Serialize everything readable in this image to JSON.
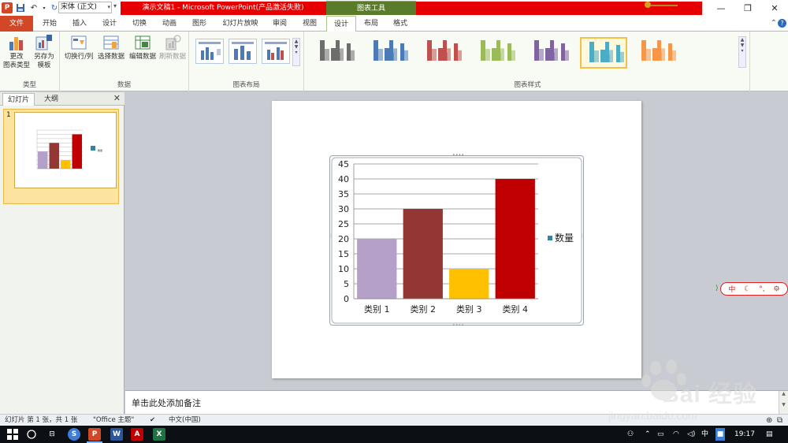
{
  "window": {
    "title": "演示文稿1 - Microsoft PowerPoint(产品激活失败)",
    "tool_tab_group": "图表工具",
    "font_name": "宋体 (正文)"
  },
  "tabs": [
    {
      "label": "文件"
    },
    {
      "label": "开始"
    },
    {
      "label": "插入"
    },
    {
      "label": "设计"
    },
    {
      "label": "切换"
    },
    {
      "label": "动画"
    },
    {
      "label": "图形"
    },
    {
      "label": "幻灯片放映"
    },
    {
      "label": "审阅"
    },
    {
      "label": "视图"
    },
    {
      "label": "设计"
    },
    {
      "label": "布局"
    },
    {
      "label": "格式"
    }
  ],
  "ribbon": {
    "type_group": {
      "label": "类型",
      "change_type": "更改\n图表类型",
      "save_template": "另存为\n模板"
    },
    "data_group": {
      "label": "数据",
      "switch_row_col": "切换行/列",
      "select_data": "选择数据",
      "edit_data": "编辑数据",
      "refresh_data": "刷新数据"
    },
    "layout_group": {
      "label": "图表布局"
    },
    "style_group": {
      "label": "图表样式"
    }
  },
  "style_colors": [
    "#6d6d6d",
    "#4a7ab8",
    "#c0504d",
    "#9bbb59",
    "#8064a2",
    "#4bacc6",
    "#f79646"
  ],
  "left_panel": {
    "tab_slides": "幻灯片",
    "tab_outline": "大纲",
    "slide_number": "1"
  },
  "chart_data": {
    "type": "bar",
    "categories": [
      "类别 1",
      "类别 2",
      "类别 3",
      "类别 4"
    ],
    "series": [
      {
        "name": "数量",
        "values": [
          20,
          30,
          10,
          40
        ]
      }
    ],
    "bar_colors": [
      "#b4a0c8",
      "#943634",
      "#ffc000",
      "#c00000"
    ],
    "legend_swatch_color": "#31859c",
    "ylim": [
      0,
      45
    ],
    "yticks": [
      0,
      5,
      10,
      15,
      20,
      25,
      30,
      35,
      40,
      45
    ],
    "grid": true,
    "legend": "right"
  },
  "notes": {
    "placeholder": "单击此处添加备注"
  },
  "statusbar": {
    "slide_info": "幻灯片 第 1 张，共 1 张",
    "theme": "\"Office 主题\"",
    "language": "中文(中国)"
  },
  "taskbar": {
    "time": "19:17",
    "ime": "中"
  },
  "watermark": {
    "text": "Bai 经验",
    "sub": "jingyan.baidu.com"
  }
}
